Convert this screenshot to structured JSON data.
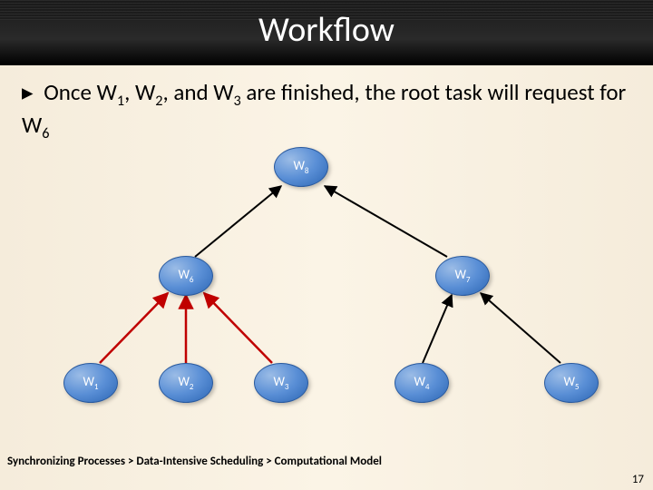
{
  "title": "Workflow",
  "bullet": {
    "prefix": "Once W",
    "s1": "1",
    "mid1": ", W",
    "s2": "2",
    "mid2": ", and W",
    "s3": "3",
    "mid3": " are finished, the root task will request for W",
    "s4": "6"
  },
  "nodes": {
    "w8_prefix": "W",
    "w8_sub": "8",
    "w6_prefix": "W",
    "w6_sub": "6",
    "w7_prefix": "W",
    "w7_sub": "7",
    "w1_prefix": "W",
    "w1_sub": "1",
    "w2_prefix": "W",
    "w2_sub": "2",
    "w3_prefix": "W",
    "w3_sub": "3",
    "w4_prefix": "W",
    "w4_sub": "4",
    "w5_prefix": "W",
    "w5_sub": "5"
  },
  "breadcrumb": "Synchronizing Processes > Data-Intensive Scheduling > Computational Model",
  "page": "17",
  "chart_data": {
    "type": "tree",
    "title": "Workflow",
    "nodes": [
      {
        "id": "W8",
        "label": "W8",
        "level": 0
      },
      {
        "id": "W6",
        "label": "W6",
        "level": 1
      },
      {
        "id": "W7",
        "label": "W7",
        "level": 1
      },
      {
        "id": "W1",
        "label": "W1",
        "level": 2
      },
      {
        "id": "W2",
        "label": "W2",
        "level": 2
      },
      {
        "id": "W3",
        "label": "W3",
        "level": 2
      },
      {
        "id": "W4",
        "label": "W4",
        "level": 2
      },
      {
        "id": "W5",
        "label": "W5",
        "level": 2
      }
    ],
    "edges": [
      {
        "from": "W6",
        "to": "W8",
        "highlight": false
      },
      {
        "from": "W7",
        "to": "W8",
        "highlight": false
      },
      {
        "from": "W1",
        "to": "W6",
        "highlight": true
      },
      {
        "from": "W2",
        "to": "W6",
        "highlight": true
      },
      {
        "from": "W3",
        "to": "W6",
        "highlight": true
      },
      {
        "from": "W4",
        "to": "W7",
        "highlight": false
      },
      {
        "from": "W5",
        "to": "W7",
        "highlight": false
      }
    ],
    "annotations": [
      "Once W1, W2, and W3 are finished, the root task will request for W6"
    ]
  }
}
